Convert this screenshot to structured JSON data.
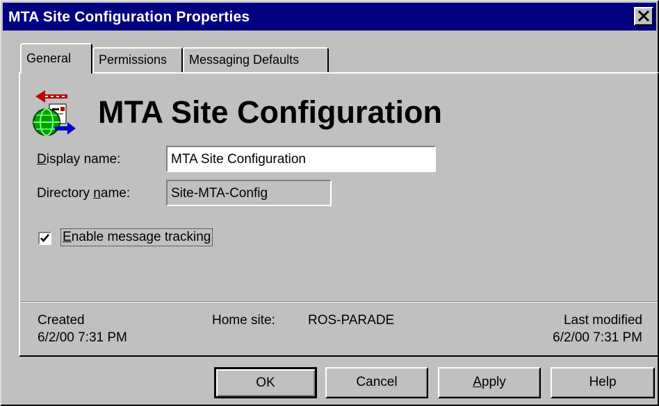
{
  "window": {
    "title": "MTA Site Configuration Properties",
    "close_glyph": "✕"
  },
  "tabs": [
    {
      "label": "General",
      "active": true
    },
    {
      "label": "Permissions",
      "active": false
    },
    {
      "label": "Messaging Defaults",
      "active": false
    }
  ],
  "general": {
    "icon": "mta-site-config-icon",
    "heading": "MTA Site Configuration",
    "display_name": {
      "label": "Display name:",
      "value": "MTA Site Configuration"
    },
    "directory_name": {
      "label": "Directory name:",
      "value": "Site-MTA-Config"
    },
    "message_tracking": {
      "label": "Enable message tracking",
      "checked": true
    },
    "info": {
      "created_label": "Created",
      "created_value": "6/2/00  7:31 PM",
      "home_site_label": "Home site:",
      "home_site_value": "ROS-PARADE",
      "last_modified_label": "Last modified",
      "last_modified_value": "6/2/00  7:31 PM"
    }
  },
  "buttons": {
    "ok": "OK",
    "cancel": "Cancel",
    "apply": "Apply",
    "help": "Help"
  },
  "colors": {
    "titlebar": "#000080",
    "face": "#c0c0c0"
  }
}
